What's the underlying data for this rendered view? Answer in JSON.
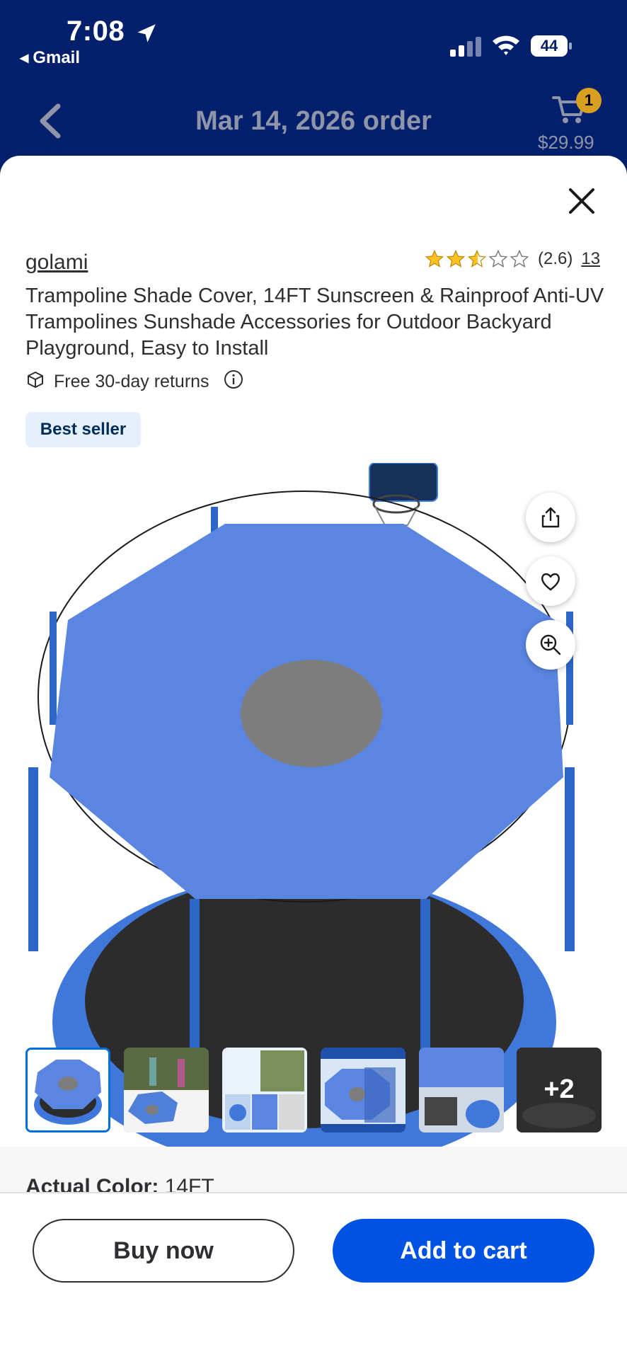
{
  "status_bar": {
    "time": "7:08",
    "back_app": "Gmail",
    "battery": "44"
  },
  "header": {
    "title": "Mar 14, 2026 order",
    "cart_count": "1",
    "cart_total": "$29.99"
  },
  "product": {
    "brand": "golami",
    "rating_value": "(2.6)",
    "rating_stars": 2.6,
    "review_count": "13",
    "title": "Trampoline Shade Cover, 14FT Sunscreen & Rainproof Anti-UV Trampolines Sunshade Accessories for Outdoor Backyard Playground, Easy to Install",
    "returns_label": "Free 30-day returns",
    "badge": "Best seller"
  },
  "gallery": {
    "more_label": "+2"
  },
  "options": {
    "color_label": "Actual Color:",
    "color_value": "14FT"
  },
  "actions": {
    "buy_now": "Buy now",
    "add_to_cart": "Add to cart"
  },
  "colors": {
    "header_bg": "#041f6b",
    "primary": "#0053e2",
    "badge_bg": "#e5f0fc",
    "star": "#ffc220",
    "cart_badge": "#d9a020"
  }
}
